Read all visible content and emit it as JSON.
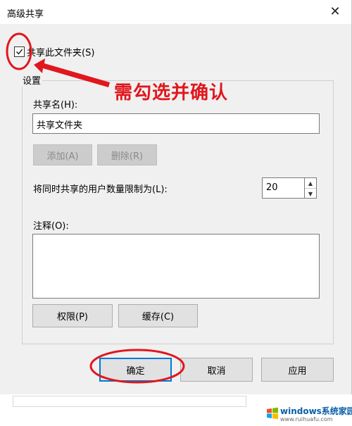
{
  "dialog": {
    "title": "高级共享",
    "close_glyph": "✕",
    "share_checkbox": {
      "label": "共享此文件夹(S)",
      "checked": true
    },
    "settings_group_label": "设置",
    "share_name": {
      "label": "共享名(H):",
      "value": "共享文件夹"
    },
    "add_button": "添加(A)",
    "remove_button": "删除(R)",
    "user_limit": {
      "label": "将同时共享的用户数量限制为(L):",
      "value": "20"
    },
    "comments": {
      "label": "注释(O):",
      "value": ""
    },
    "permissions_button": "权限(P)",
    "caching_button": "缓存(C)",
    "ok_button": "确定",
    "cancel_button": "取消",
    "apply_button": "应用"
  },
  "annotation": {
    "text": "需勾选并确认",
    "color": "#e0171d"
  },
  "watermark": {
    "brand": "windows系统家园",
    "url": "www.ruihuafu.com"
  },
  "colors": {
    "dialog_bg": "#f0f0f0",
    "accent_blue": "#0078d7",
    "annotation_red": "#e0171d"
  }
}
